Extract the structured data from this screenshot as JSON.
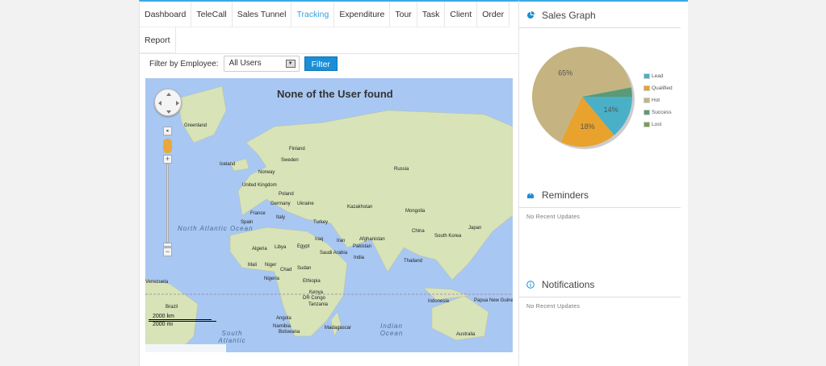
{
  "nav": {
    "tabs": [
      "Dashboard",
      "TeleCall",
      "Sales Tunnel",
      "Tracking",
      "Expenditure",
      "Tour",
      "Task",
      "Client",
      "Order",
      "Report"
    ],
    "active": "Tracking"
  },
  "filter": {
    "label": "Filter by Employee:",
    "selected": "All Users",
    "button": "Filter"
  },
  "map": {
    "message": "None of the User found",
    "labels": [
      "Greenland",
      "Iceland",
      "Finland",
      "Sweden",
      "Norway",
      "Russia",
      "United Kingdom",
      "Poland",
      "Germany",
      "Ukraine",
      "France",
      "Italy",
      "Spain",
      "Turkey",
      "Kazakhstan",
      "Mongolia",
      "China",
      "South Korea",
      "Japan",
      "Iraq",
      "Iran",
      "Afghanistan",
      "Pakistan",
      "India",
      "Algeria",
      "Libya",
      "Egypt",
      "Saudi Arabia",
      "Mali",
      "Niger",
      "Chad",
      "Sudan",
      "Nigeria",
      "Ethiopia",
      "Kenya",
      "DR Congo",
      "Tanzania",
      "Angola",
      "Namibia",
      "Botswana",
      "Madagascar",
      "Brazil",
      "Thailand",
      "Indonesia",
      "Papua New Guinea",
      "Australia",
      "Venezuela"
    ],
    "oceans": [
      "North Atlantic Ocean",
      "South Atlantic",
      "Indian Ocean"
    ],
    "scale": [
      "2000 km",
      "2000 mi"
    ]
  },
  "sales_graph": {
    "title": "Sales Graph",
    "chart_data": {
      "type": "pie",
      "slices": [
        {
          "name": "Lead",
          "value": 14,
          "color": "#4ab0c8"
        },
        {
          "name": "Qualified",
          "value": 18,
          "color": "#e9a22c"
        },
        {
          "name": "Hot",
          "value": 65,
          "color": "#c5b482"
        },
        {
          "name": "Success",
          "value": 3,
          "color": "#5a9a78"
        },
        {
          "name": "Lost",
          "value": 0,
          "color": "#7d9c55"
        }
      ],
      "labels": [
        "14%",
        "18%",
        "65%"
      ]
    }
  },
  "reminders": {
    "title": "Reminders",
    "text": "No Recent Updates"
  },
  "notifications": {
    "title": "Notifications",
    "text": "No Recent Updates"
  }
}
